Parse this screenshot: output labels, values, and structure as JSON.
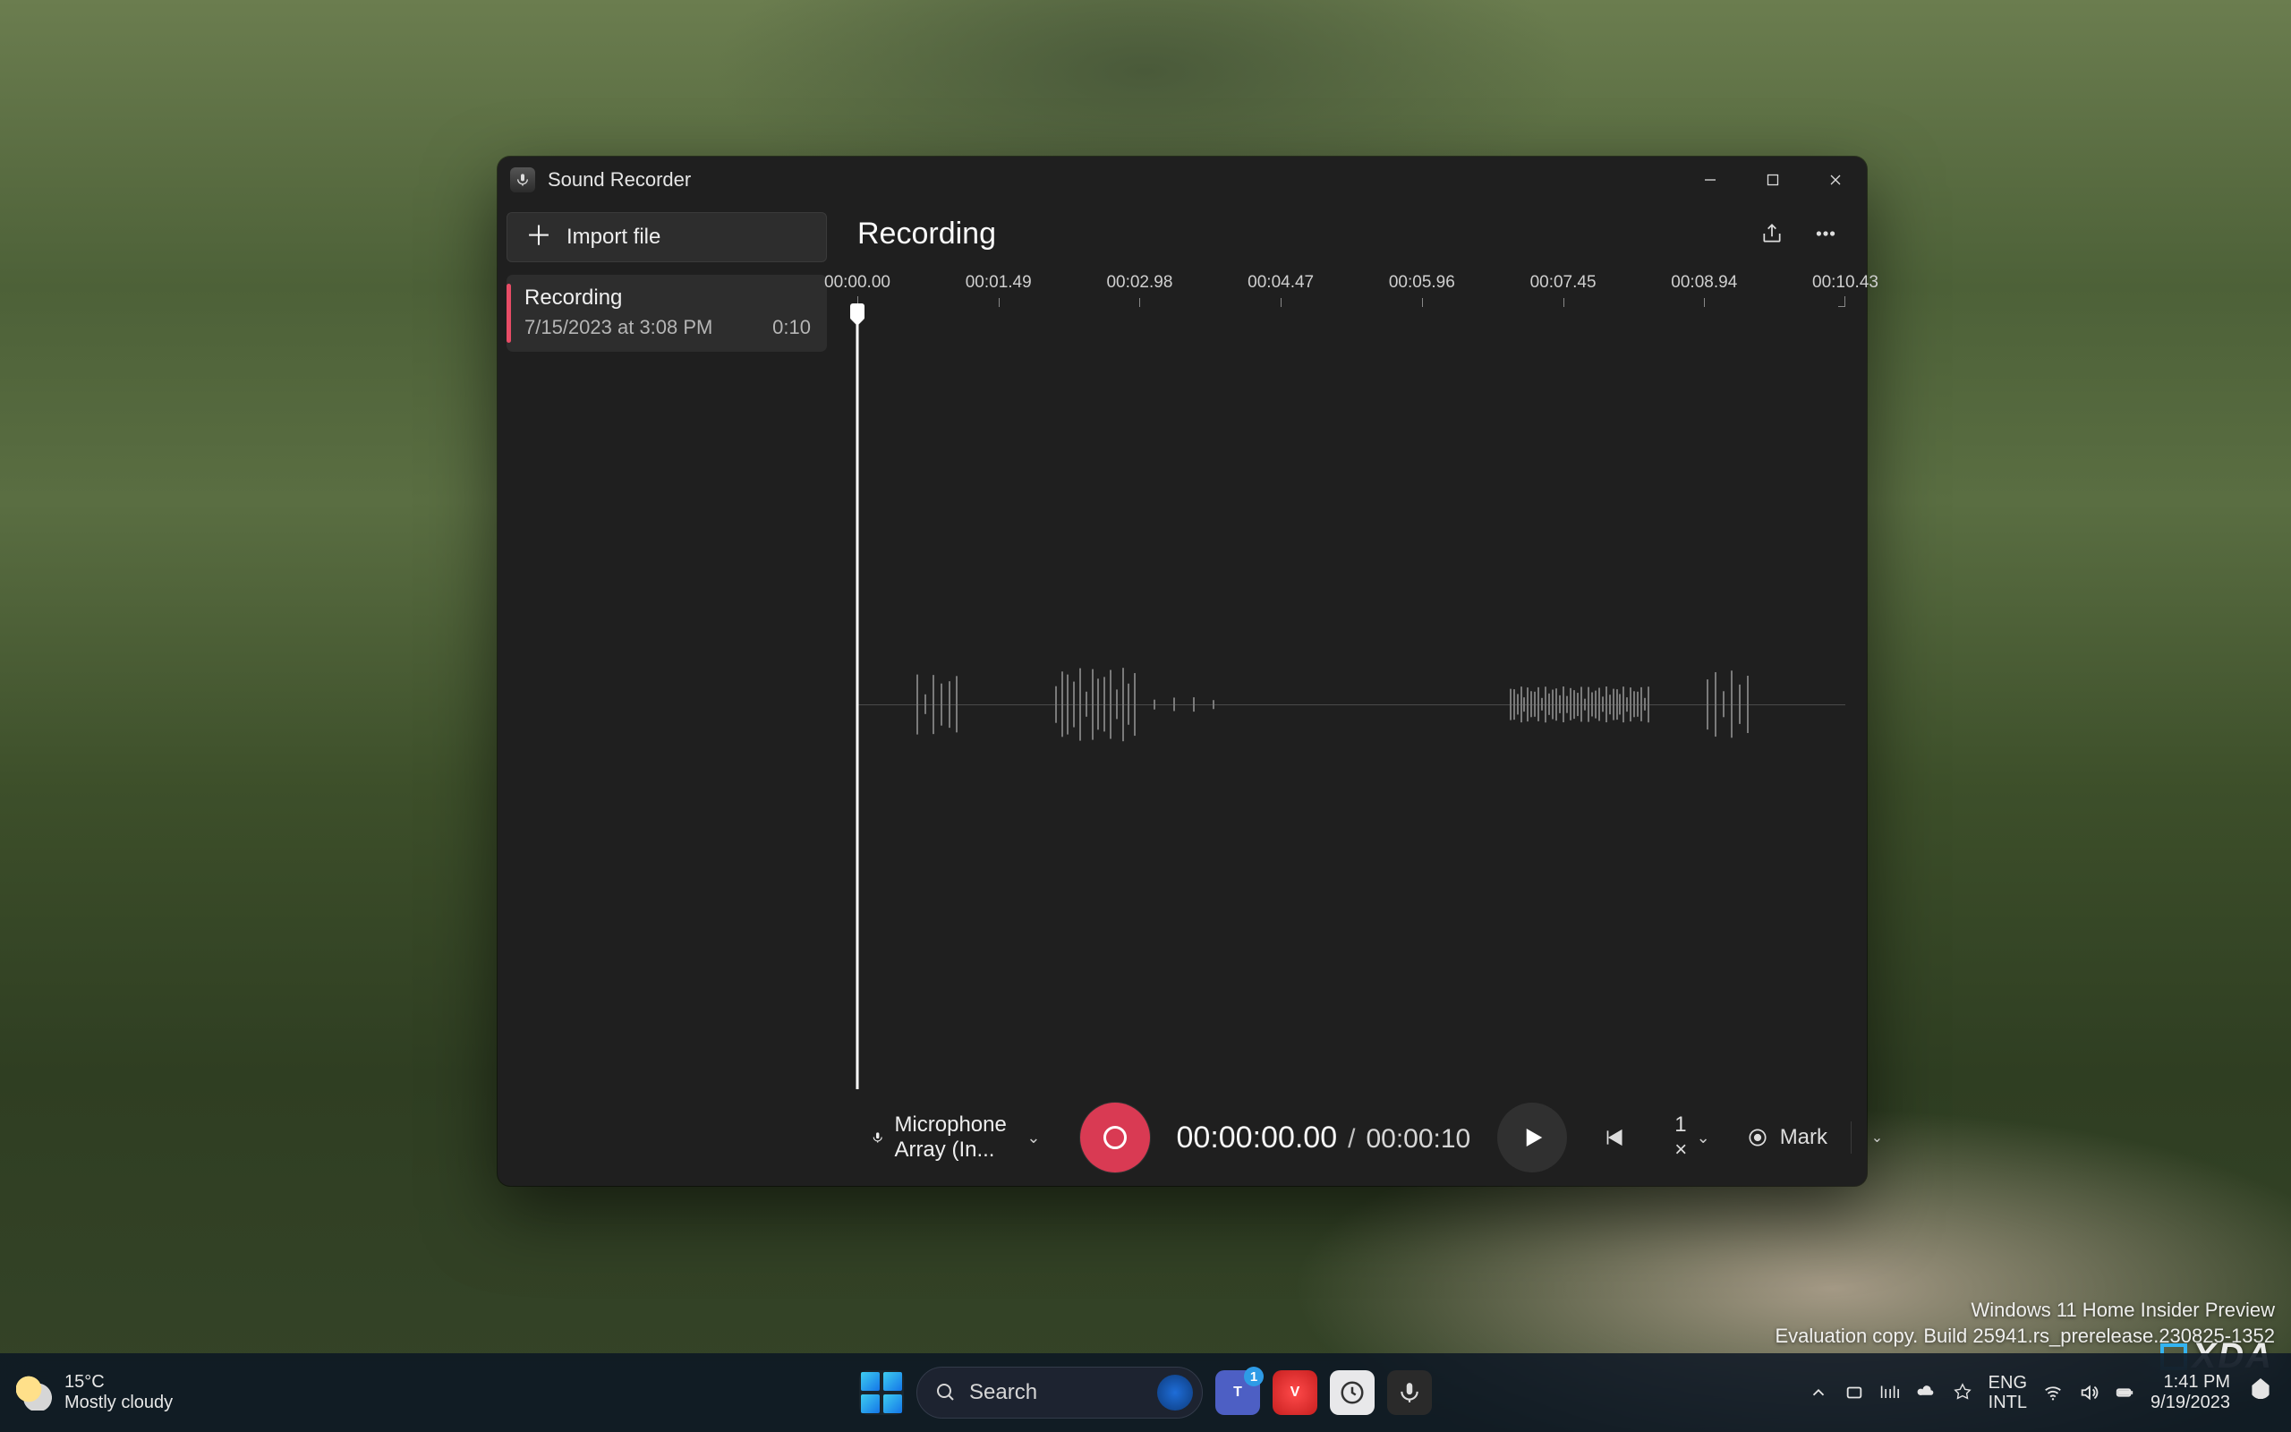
{
  "app": {
    "title": "Sound Recorder",
    "import_label": "Import file"
  },
  "recordings": [
    {
      "name": "Recording",
      "datetime": "7/15/2023 at 3:08 PM",
      "duration": "0:10"
    }
  ],
  "main": {
    "title": "Recording",
    "ruler_ticks": [
      "00:00.00",
      "00:01.49",
      "00:02.98",
      "00:04.47",
      "00:05.96",
      "00:07.45",
      "00:08.94",
      "00:10.43"
    ]
  },
  "controls": {
    "mic_label": "Microphone Array (In...",
    "time_current": "00:00:00.00",
    "time_total": "00:00:10",
    "speed_label": "1 ×",
    "mark_label": "Mark"
  },
  "desktop": {
    "line1": "Windows 11 Home Insider Preview",
    "line2": "Evaluation copy. Build 25941.rs_prerelease.230825-1352",
    "xda": "XDA"
  },
  "taskbar": {
    "weather_temp": "15°C",
    "weather_desc": "Mostly cloudy",
    "search_placeholder": "Search",
    "teams_badge": "1",
    "lang_top": "ENG",
    "lang_bottom": "INTL",
    "time": "1:41 PM",
    "date": "9/19/2023"
  },
  "colors": {
    "accent_record": "#d93a53",
    "item_accent": "#e74c66"
  }
}
